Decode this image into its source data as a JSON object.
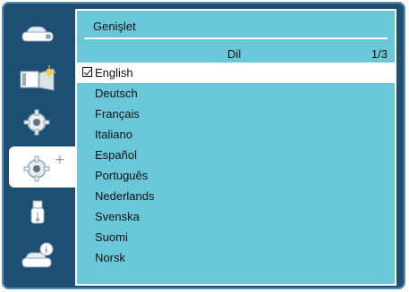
{
  "panel": {
    "title": "Genişlet",
    "section": "Dil",
    "page": "1/3"
  },
  "sidebar": {
    "items": [
      {
        "name": "camera-icon"
      },
      {
        "name": "projector-display-icon"
      },
      {
        "name": "gear-icon"
      },
      {
        "name": "gear-plus-icon"
      },
      {
        "name": "usb-icon"
      },
      {
        "name": "camera-info-icon"
      }
    ]
  },
  "languages": [
    "English",
    "Deutsch",
    "Français",
    "Italiano",
    "Español",
    "Português",
    "Nederlands",
    "Svenska",
    "Suomi",
    "Norsk"
  ],
  "selected_language": "English"
}
